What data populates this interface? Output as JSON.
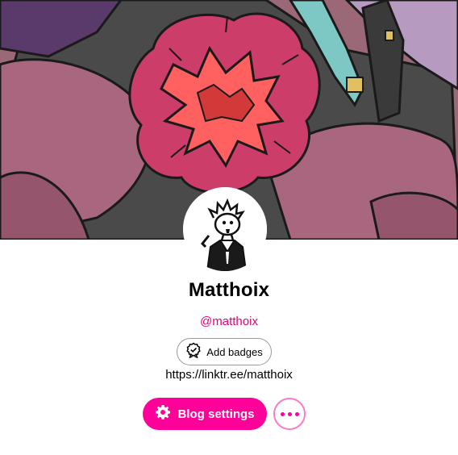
{
  "profile": {
    "name": "Matthoix",
    "handle": "@matthoix",
    "link": "https://linktr.ee/matthoix"
  },
  "actions": {
    "add_badges_label": "Add badges",
    "blog_settings_label": "Blog settings",
    "more_label": "More options"
  },
  "icons": {
    "badge": "badge-icon",
    "settings": "gear-icon",
    "more": "ellipsis-icon"
  },
  "colors": {
    "accent": "#ff0099",
    "handle": "#e6007a",
    "more_border": "#ff7ac2"
  }
}
